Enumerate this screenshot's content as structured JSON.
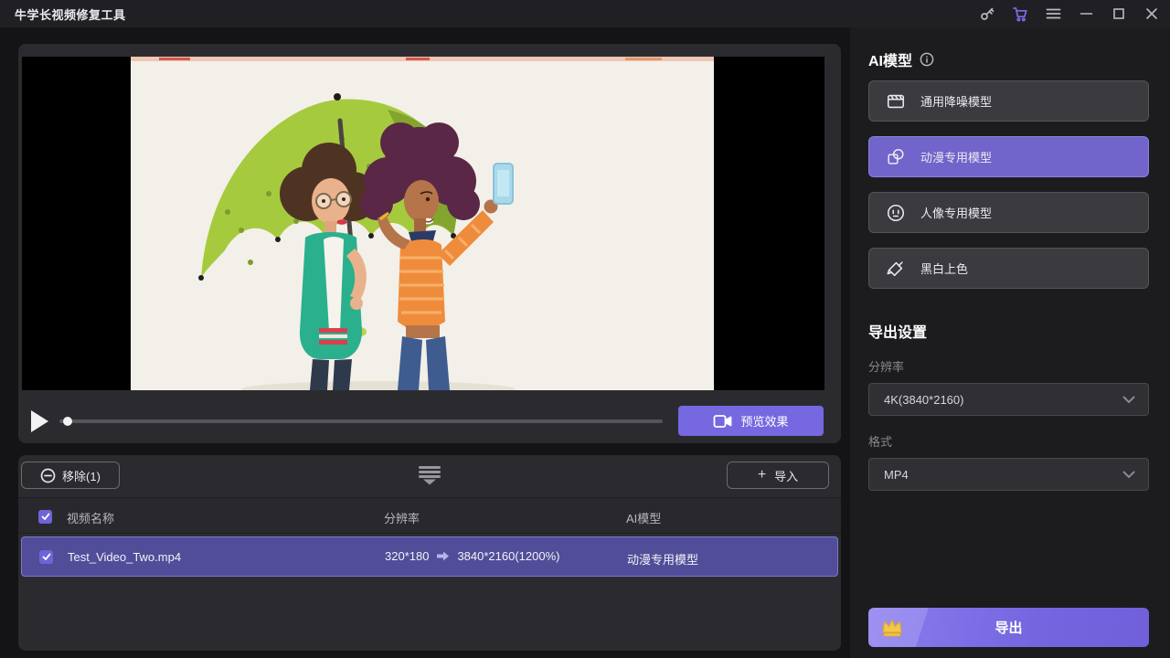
{
  "window": {
    "title": "牛学长视频修复工具"
  },
  "titlebar_icons": [
    "key-icon",
    "cart-icon",
    "menu-icon",
    "minimize-icon",
    "maximize-icon",
    "close-icon"
  ],
  "player": {
    "state": "paused",
    "progress_percent": 0,
    "preview_button_label": "预览效果"
  },
  "file_list": {
    "remove_button_label": "移除(1)",
    "import_button_plus": "+",
    "import_button_label": "导入",
    "columns": [
      "视频名称",
      "分辨率",
      "AI模型"
    ],
    "rows": [
      {
        "name": "Test_Video_Two.mp4",
        "resolution_from": "320*180",
        "resolution_to": "3840*2160(1200%)",
        "ai_model": "动漫专用模型",
        "checked": true,
        "selected": true
      }
    ]
  },
  "sidebar": {
    "section_title": "AI模型",
    "models": [
      {
        "label": "通用降噪模型",
        "icon": "film-clapper-icon",
        "selected": false
      },
      {
        "label": "动漫专用模型",
        "icon": "anime-shapes-icon",
        "selected": true
      },
      {
        "label": "人像专用模型",
        "icon": "portrait-face-icon",
        "selected": false
      },
      {
        "label": "黑白上色",
        "icon": "colorize-brush-icon",
        "selected": false
      }
    ],
    "export_settings": {
      "section_title": "导出设置",
      "resolution_label": "分辨率",
      "resolution_value": "4K(3840*2160)",
      "format_label": "格式",
      "format_value": "MP4"
    },
    "export_button_label": "导出"
  },
  "colors": {
    "accent_purple": "#7568e0",
    "selected_model_bg": "#7164ca",
    "selected_row_bg": "#524d99",
    "panel_bg": "#2b2b2f",
    "sidebar_bg": "#1c1c1f",
    "window_bg": "#141416",
    "crown_gold": "#f2c84b",
    "umbrella_green": "#a6ca3e"
  }
}
